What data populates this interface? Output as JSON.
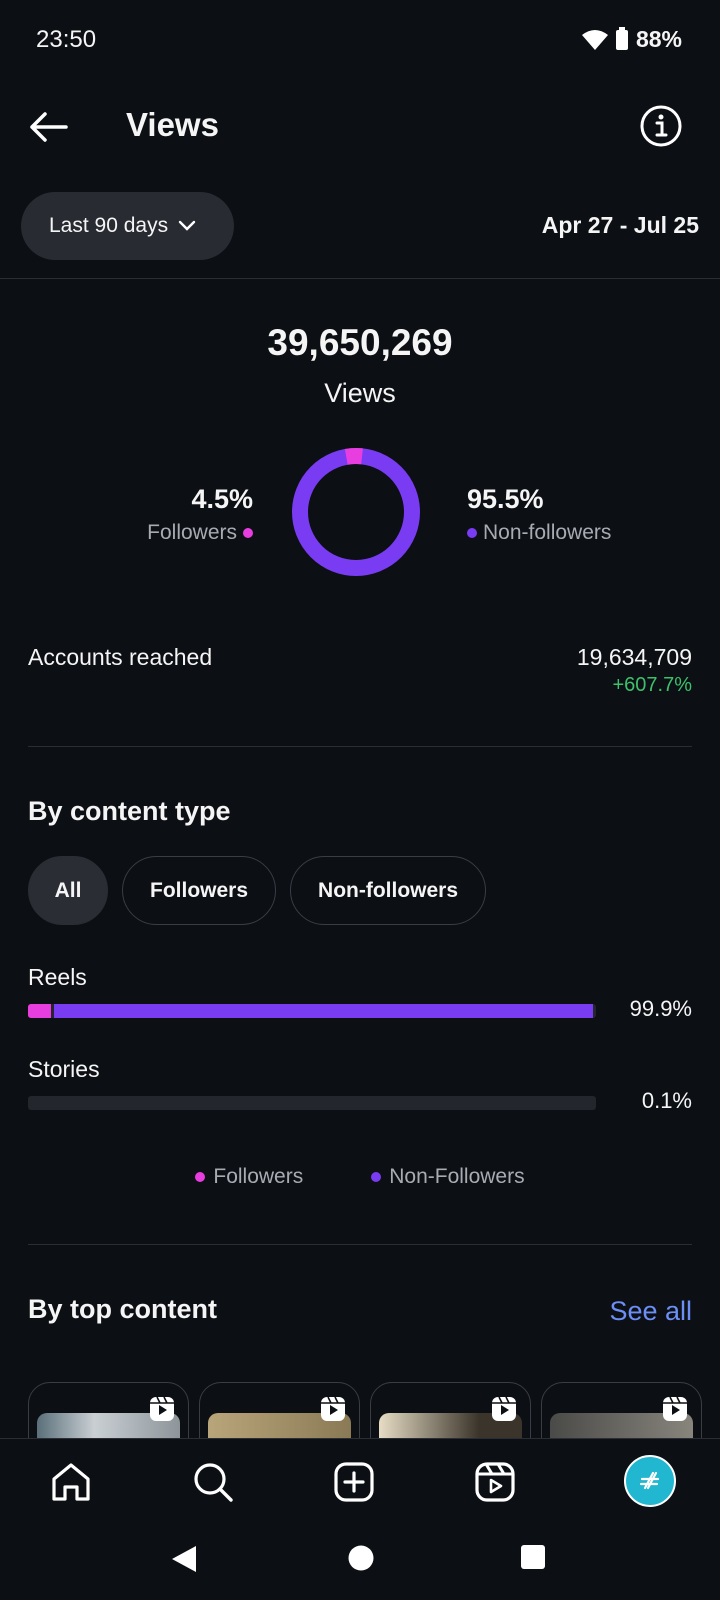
{
  "status": {
    "time": "23:50",
    "battery": "88%"
  },
  "header": {
    "title": "Views"
  },
  "filter": {
    "range_label": "Last 90 days",
    "date_range": "Apr 27 - Jul 25"
  },
  "summary": {
    "total_views": "39,650,269",
    "total_label": "Views",
    "followers_pct": "4.5%",
    "followers_label": "Followers",
    "nonfollowers_pct": "95.5%",
    "nonfollowers_label": "Non-followers",
    "followers_fraction": 0.045
  },
  "reach": {
    "label": "Accounts reached",
    "value": "19,634,709",
    "change": "+607.7%"
  },
  "content_type": {
    "title": "By content type",
    "chips": [
      "All",
      "Followers",
      "Non-followers"
    ],
    "active_chip": "All",
    "rows": [
      {
        "label": "Reels",
        "pct": "99.9%",
        "followers_fraction": 0.04,
        "nonfollowers_fraction": 0.955
      },
      {
        "label": "Stories",
        "pct": "0.1%",
        "followers_fraction": 0.0,
        "nonfollowers_fraction": 0.0
      }
    ],
    "legend": [
      "Followers",
      "Non-Followers"
    ]
  },
  "top_content": {
    "title": "By top content",
    "see_all": "See all"
  },
  "colors": {
    "followers": "#e83ee0",
    "nonfollowers": "#7a3cf2",
    "positive": "#3cc06a",
    "link": "#6c8ff6"
  }
}
